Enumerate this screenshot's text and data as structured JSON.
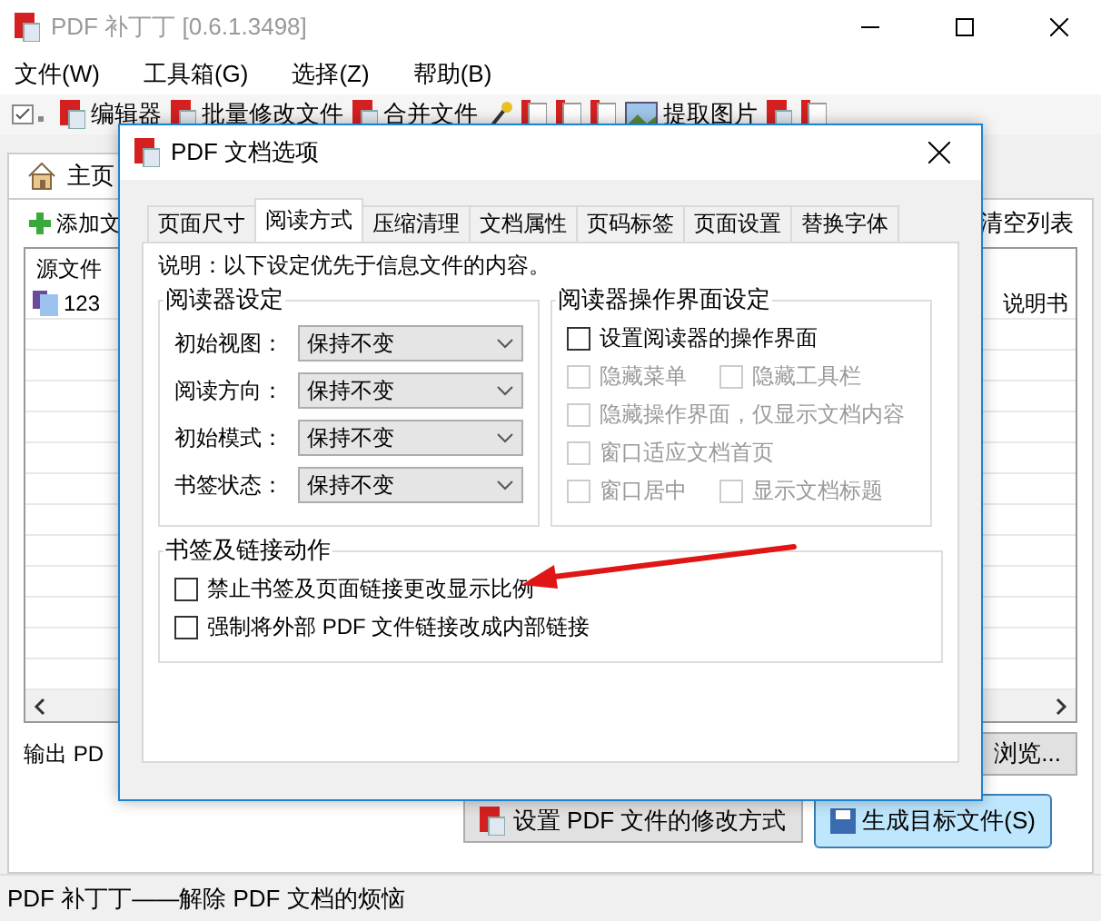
{
  "window": {
    "title": "PDF 补丁丁 [0.6.1.3498]"
  },
  "menu": [
    "文件(W)",
    "工具箱(G)",
    "选择(Z)",
    "帮助(B)"
  ],
  "toolbar": [
    {
      "kind": "check"
    },
    {
      "kind": "pdf",
      "label": "编辑器"
    },
    {
      "kind": "pdf",
      "label": "批量修改文件"
    },
    {
      "kind": "pdf",
      "label": "合并文件"
    },
    {
      "kind": "tool"
    },
    {
      "kind": "page"
    },
    {
      "kind": "page"
    },
    {
      "kind": "page"
    },
    {
      "kind": "image",
      "label": "提取图片"
    },
    {
      "kind": "pdf"
    },
    {
      "kind": "page"
    }
  ],
  "tabs": [
    {
      "label": "主页",
      "selected": true
    }
  ],
  "list_toolbar": {
    "add": "添加文",
    "clear": "清空列表"
  },
  "file_list": {
    "header": "源文件",
    "rows": [
      {
        "name": "123",
        "note": "说明书"
      }
    ]
  },
  "output": {
    "label": "输出 PD",
    "browse": "浏览..."
  },
  "actions": [
    {
      "label": "设置 PDF 文件的修改方式",
      "kind": "normal"
    },
    {
      "label": "生成目标文件(S)",
      "kind": "primary"
    }
  ],
  "status_bar": "PDF 补丁丁——解除 PDF 文档的烦恼",
  "dialog": {
    "title": "PDF 文档选项",
    "tabs": [
      {
        "label": "页面尺寸",
        "selected": false
      },
      {
        "label": "阅读方式",
        "selected": true
      },
      {
        "label": "压缩清理",
        "selected": false
      },
      {
        "label": "文档属性",
        "selected": false
      },
      {
        "label": "页码标签",
        "selected": false
      },
      {
        "label": "页面设置",
        "selected": false
      },
      {
        "label": "替换字体",
        "selected": false
      }
    ],
    "note": "说明：以下设定优先于信息文件的内容。",
    "reader": {
      "title": "阅读器设定",
      "fields": [
        {
          "label": "初始视图：",
          "value": "保持不变"
        },
        {
          "label": "阅读方向：",
          "value": "保持不变"
        },
        {
          "label": "初始模式：",
          "value": "保持不变"
        },
        {
          "label": "书签状态：",
          "value": "保持不变"
        }
      ]
    },
    "reader_ui": {
      "title": "阅读器操作界面设定",
      "rows": [
        {
          "items": [
            {
              "label": "设置阅读器的操作界面",
              "checked": false,
              "disabled": false
            }
          ]
        },
        {
          "items": [
            {
              "label": "隐藏菜单",
              "checked": false,
              "disabled": true
            },
            {
              "label": "隐藏工具栏",
              "checked": false,
              "disabled": true
            }
          ]
        },
        {
          "items": [
            {
              "label": "隐藏操作界面，仅显示文档内容",
              "checked": false,
              "disabled": true
            }
          ]
        },
        {
          "items": [
            {
              "label": "窗口适应文档首页",
              "checked": false,
              "disabled": true
            }
          ]
        },
        {
          "items": [
            {
              "label": "窗口居中",
              "checked": false,
              "disabled": true
            },
            {
              "label": "显示文档标题",
              "checked": false,
              "disabled": true
            }
          ]
        }
      ]
    },
    "links": {
      "title": "书签及链接动作",
      "options": [
        {
          "label": "禁止书签及页面链接更改显示比例",
          "checked": false,
          "disabled": false
        },
        {
          "label": "强制将外部 PDF 文件链接改成内部链接",
          "checked": false,
          "disabled": false
        }
      ]
    }
  },
  "annotation": {
    "kind": "arrow"
  }
}
